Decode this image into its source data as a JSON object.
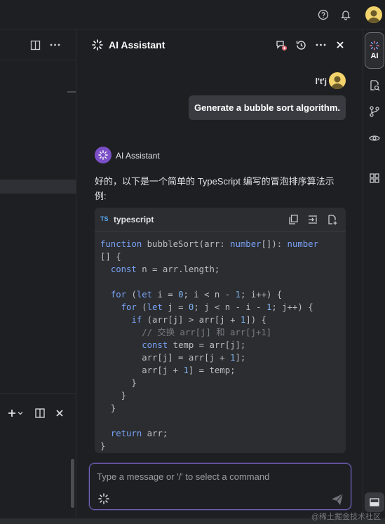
{
  "colors": {
    "accent": "#7a5fc0",
    "background": "#1e1f22",
    "bubble": "#393b40",
    "code_bg": "#2b2d30",
    "keyword": "#7aa2f7"
  },
  "topbar": {
    "icons": [
      "help-icon",
      "bell-icon",
      "user-avatar"
    ]
  },
  "left_pane": {
    "icons": [
      "split-view-icon",
      "more-icon",
      "add-icon",
      "chevron-down-icon",
      "split-view-icon",
      "close-icon"
    ]
  },
  "panel": {
    "title": "AI Assistant",
    "header_icons": [
      "new-chat-icon",
      "history-icon",
      "more-icon",
      "close-icon"
    ],
    "user": {
      "name": "l't'j",
      "message": "Generate a bubble sort algorithm."
    },
    "assistant": {
      "name": "AI Assistant",
      "intro": "好的，以下是一个简单的 TypeScript 编写的冒泡排序算法示例:",
      "code_block": {
        "badge": "TS",
        "language": "typescript",
        "toolbar_icons": [
          "copy-icon",
          "insert-icon",
          "new-file-icon"
        ],
        "lines": [
          "function bubbleSort(arr: number[]): number",
          "[] {",
          "  const n = arr.length;",
          "",
          "  for (let i = 0; i < n - 1; i++) {",
          "    for (let j = 0; j < n - i - 1; j++) {",
          "      if (arr[j] > arr[j + 1]) {",
          "        // 交换 arr[j] 和 arr[j+1]",
          "        const temp = arr[j];",
          "        arr[j] = arr[j + 1];",
          "        arr[j + 1] = temp;",
          "      }",
          "    }",
          "  }",
          "",
          "  return arr;",
          "}"
        ]
      }
    },
    "input": {
      "placeholder": "Type a message or '/' to select a command",
      "value": ""
    }
  },
  "strip": {
    "ai_label": "AI",
    "icons": [
      "ai-sparkle-icon",
      "file-search-icon",
      "git-branch-icon",
      "eye-icon",
      "grid-icon",
      "terminal-icon"
    ]
  },
  "watermark": "@稀土掘金技术社区"
}
